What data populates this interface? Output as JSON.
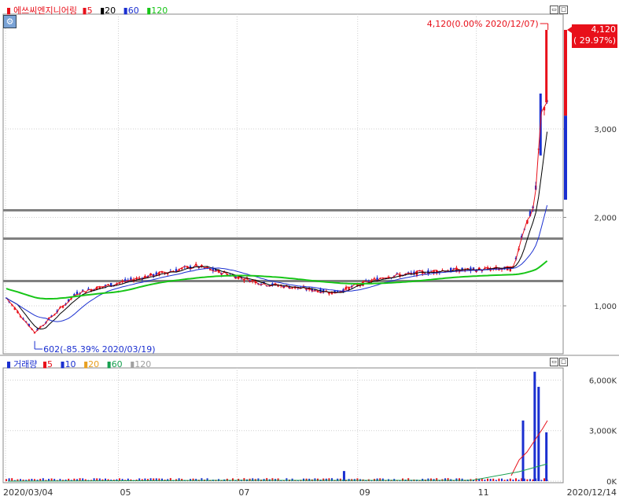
{
  "price_panel": {
    "legend_name": "에쓰씨엔지니어링",
    "legend_items": [
      {
        "label": "5",
        "color": "#e8101a"
      },
      {
        "label": "20",
        "color": "#000000"
      },
      {
        "label": "60",
        "color": "#1a2fd0"
      },
      {
        "label": "120",
        "color": "#17c517"
      }
    ],
    "high_annotation": "4,120(0.00% 2020/12/07)",
    "low_annotation": "602(-85.39% 2020/03/19)",
    "current_price": "4,120",
    "current_change": "( 29.97%)",
    "y_ticks": [
      "1,000",
      "2,000",
      "3,000"
    ],
    "settings_icon": "settings-icon"
  },
  "volume_panel": {
    "legend_name": "거래량",
    "legend_items": [
      {
        "label": "5",
        "color": "#e8101a"
      },
      {
        "label": "10",
        "color": "#1a2fd0"
      },
      {
        "label": "20",
        "color": "#e8a020"
      },
      {
        "label": "60",
        "color": "#17a050"
      },
      {
        "label": "120",
        "color": "#a0a0a0"
      }
    ],
    "y_ticks": [
      "0K",
      "3,000K",
      "6,000K"
    ]
  },
  "x_axis": {
    "labels": [
      "2020/03/04",
      "05",
      "07",
      "09",
      "11",
      "2020/12/14"
    ]
  },
  "chart_data": {
    "type": "candlestick",
    "period": {
      "start": "2020/03/04",
      "end": "2020/12/14"
    },
    "price_axis": {
      "ylim": [
        500,
        4500
      ],
      "ticks": [
        1000,
        2000,
        3000
      ]
    },
    "volume_axis": {
      "ylim": [
        0,
        7000
      ],
      "ticks": [
        0,
        3000,
        6000
      ],
      "unit": "K"
    },
    "moving_averages": [
      5,
      20,
      60,
      120
    ],
    "horizontal_lines": [
      1280,
      1760,
      2080
    ],
    "annotations": [
      {
        "date": "2020/12/07",
        "value": 4120,
        "text": "4,120(0.00% 2020/12/07)",
        "kind": "high"
      },
      {
        "date": "2020/03/19",
        "value": 602,
        "text": "602(-85.39% 2020/03/19)",
        "kind": "low"
      }
    ],
    "last": {
      "date": "2020/12/14",
      "close": 4120,
      "change_pct": 29.97
    },
    "key_points": [
      {
        "date": "2020/03/04",
        "close": 1100
      },
      {
        "date": "2020/03/19",
        "close": 700
      },
      {
        "date": "2020/04/10",
        "close": 1150
      },
      {
        "date": "2020/05/15",
        "close": 1330
      },
      {
        "date": "2020/06/10",
        "close": 1450
      },
      {
        "date": "2020/07/15",
        "close": 1250
      },
      {
        "date": "2020/08/20",
        "close": 1150
      },
      {
        "date": "2020/09/15",
        "close": 1330
      },
      {
        "date": "2020/10/15",
        "close": 1400
      },
      {
        "date": "2020/11/20",
        "close": 1420
      },
      {
        "date": "2020/11/25",
        "close": 1850
      },
      {
        "date": "2020/12/01",
        "close": 2150
      },
      {
        "date": "2020/12/03",
        "close": 2750
      },
      {
        "date": "2020/12/04",
        "close": 3150
      },
      {
        "date": "2020/12/07",
        "close": 3300
      },
      {
        "date": "2020/12/14",
        "close": 4120
      }
    ],
    "volume_spikes": [
      {
        "date": "2020/08/25",
        "value": 600
      },
      {
        "date": "2020/11/25",
        "value": 3600
      },
      {
        "date": "2020/12/01",
        "value": 6500
      },
      {
        "date": "2020/12/03",
        "value": 5600
      },
      {
        "date": "2020/12/07",
        "value": 2900
      }
    ]
  }
}
